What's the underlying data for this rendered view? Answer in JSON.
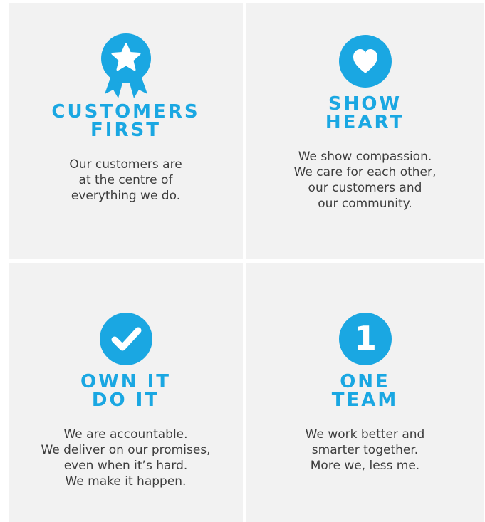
{
  "colors": {
    "accent": "#1aa7e2",
    "card_bg": "#f2f2f2",
    "text": "#3d3d3d"
  },
  "values": [
    {
      "icon": "award-ribbon-icon",
      "title_line1": "CUSTOMERS",
      "title_line2": "FIRST",
      "description": "Our customers are\nat the centre of\neverything we do."
    },
    {
      "icon": "heart-icon",
      "title_line1": "SHOW",
      "title_line2": "HEART",
      "description": "We show compassion.\nWe care for each other,\nour customers and\nour community."
    },
    {
      "icon": "checkmark-icon",
      "title_line1": "OWN IT",
      "title_line2": "DO IT",
      "description": "We are accountable.\nWe deliver on our promises,\neven when it’s hard.\nWe make it happen."
    },
    {
      "icon": "number-one-icon",
      "title_line1": "ONE",
      "title_line2": "TEAM",
      "description": "We work better and\nsmarter together.\nMore we, less me.",
      "icon_text": "1"
    }
  ]
}
